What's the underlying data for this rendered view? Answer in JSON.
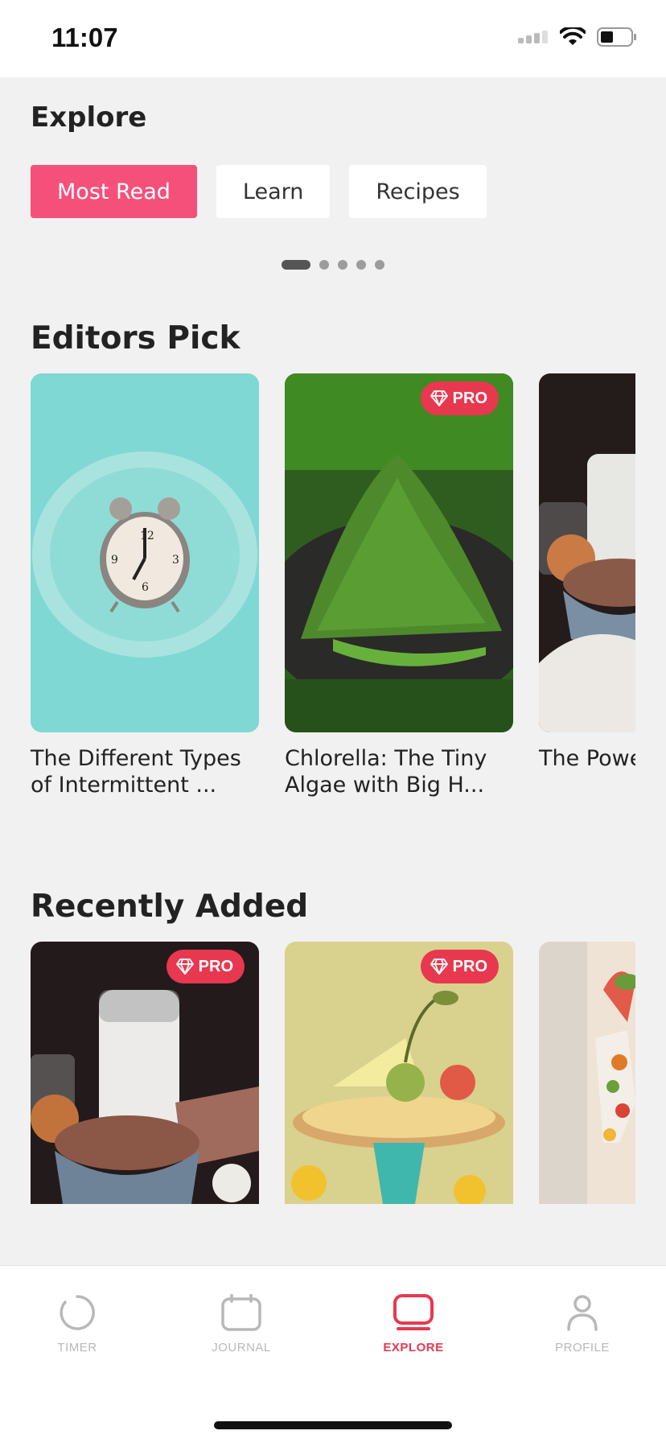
{
  "status_bar": {
    "time": "11:07"
  },
  "explore": {
    "title": "Explore",
    "tabs": [
      {
        "label": "Most Read",
        "active": true
      },
      {
        "label": "Learn",
        "active": false
      },
      {
        "label": "Recipes",
        "active": false
      }
    ],
    "pager": {
      "pages": 5,
      "current": 1
    }
  },
  "editors_pick": {
    "title": "Editors Pick",
    "cards": [
      {
        "title": "The Different Types of Intermittent ...",
        "pro": false,
        "image": "alarm-clock-on-plate"
      },
      {
        "title": "Chlorella: The Tiny Algae with Big H...",
        "pro": true,
        "image": "green-powder-mound"
      },
      {
        "title": "The Powe How Lean",
        "pro": false,
        "image": "milk-and-protein-powder"
      }
    ]
  },
  "recently_added": {
    "title": "Recently Added",
    "cards": [
      {
        "pro": true,
        "image": "milk-and-chocolate-powder"
      },
      {
        "pro": true,
        "image": "fruit-pizza-on-stand"
      },
      {
        "pro": false,
        "image": "fruit-figure-illustration"
      }
    ]
  },
  "pro_label": "PRO",
  "tab_bar": {
    "items": [
      {
        "label": "TIMER",
        "icon": "timer-icon",
        "active": false
      },
      {
        "label": "JOURNAL",
        "icon": "calendar-icon",
        "active": false
      },
      {
        "label": "EXPLORE",
        "icon": "explore-icon",
        "active": true
      },
      {
        "label": "PROFILE",
        "icon": "profile-icon",
        "active": false
      }
    ]
  },
  "colors": {
    "accent": "#f5507a",
    "pro_badge": "#e8384f",
    "background": "#f1f1f1"
  }
}
